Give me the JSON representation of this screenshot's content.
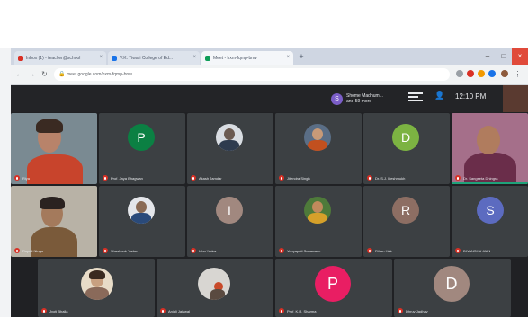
{
  "browser": {
    "tabs": [
      {
        "label": "Inbox (1) - teacher@school",
        "favicon_color": "#d93025"
      },
      {
        "label": "V.K. Tiwari College of Ed...",
        "favicon_color": "#1a73e8"
      },
      {
        "label": "Meet - hxm-fqmp-bnw",
        "favicon_color": "#0f9d58"
      }
    ],
    "url": "meet.google.com/hxm-fqmp-bnw"
  },
  "meet": {
    "presenter": {
      "initial": "S",
      "line1": "Shome Madhum...",
      "line2": "and 59 more"
    },
    "clock": "12:10 PM",
    "tiles": [
      {
        "type": "video",
        "name": "Riya"
      },
      {
        "type": "avatar",
        "initial": "P",
        "color": "#0b8043",
        "name": "Prof. Jaya Bhagwan"
      },
      {
        "type": "photo",
        "name": "Akash Jamdar"
      },
      {
        "type": "photo",
        "name": "Jitendra Singh"
      },
      {
        "type": "avatar",
        "initial": "D",
        "color": "#7cb342",
        "name": "Dr. S.J. Deshmukh"
      },
      {
        "type": "video",
        "name": "Dr. Sangeeta Dhingra"
      },
      {
        "type": "video",
        "name": "Rupali Ninga"
      },
      {
        "type": "photo",
        "name": "Shashank Yadav"
      },
      {
        "type": "avatar",
        "initial": "I",
        "color": "#a1887f",
        "name": "Isha Yadav"
      },
      {
        "type": "photo",
        "name": "Vanyapati Sonawane"
      },
      {
        "type": "avatar",
        "initial": "R",
        "color": "#8d6e63",
        "name": "Rihan Hak"
      },
      {
        "type": "avatar",
        "initial": "S",
        "color": "#5c6bc0",
        "name": "DIVANSHU JAIN"
      },
      {
        "type": "photo",
        "name": "Jyoti Bhalla"
      },
      {
        "type": "photo",
        "name": "Anjali Jaiswal"
      },
      {
        "type": "avatar",
        "initial": "P",
        "color": "#e91e63",
        "name": "Prof. K.R. Sharma"
      },
      {
        "type": "avatar",
        "initial": "D",
        "color": "#a1887f",
        "name": "Dhruv Jadhav"
      }
    ]
  }
}
